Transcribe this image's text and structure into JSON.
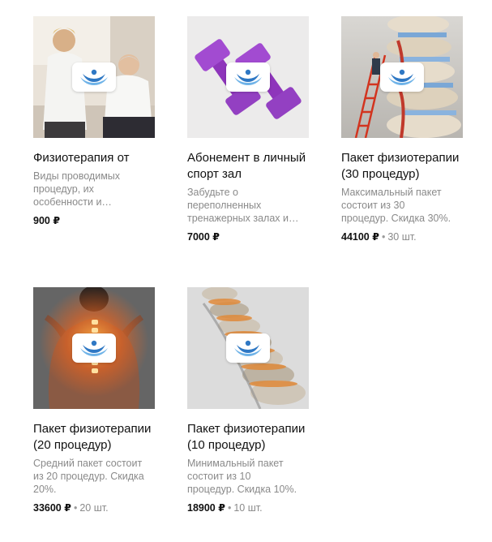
{
  "currency": "₽",
  "products": [
    {
      "title": "Физиотерапия от",
      "description": "Виды проводимых процедур, их особенности и…",
      "price": "900 ₽",
      "separator": "",
      "quantity": ""
    },
    {
      "title": "Абонемент в личный спорт зал",
      "description": "Забудьте о переполненных тренажерных залах и…",
      "price": "7000 ₽",
      "separator": "",
      "quantity": ""
    },
    {
      "title": "Пакет физиотерапии (30 процедур)",
      "description": "Максимальный пакет состоит из 30 процедур. Скидка 30%.",
      "price": "44100 ₽",
      "separator": "•",
      "quantity": "30 шт."
    },
    {
      "title": "Пакет физиотерапии (20 процедур)",
      "description": "Средний пакет состоит из 20 процедур. Скидка 20%.",
      "price": "33600 ₽",
      "separator": "•",
      "quantity": "20 шт."
    },
    {
      "title": "Пакет физиотерапии (10 процедур)",
      "description": "Минимальный пакет состоит из 10 процедур. Скидка 10%.",
      "price": "18900 ₽",
      "separator": "•",
      "quantity": "10 шт."
    }
  ],
  "colors": {
    "logo_blue": "#2f78c4",
    "logo_light": "#6fb3e8",
    "dumbbell_purple": "#9b3fc8",
    "spine_orange": "#e8641f"
  },
  "icons": [
    "physio-logo-icon"
  ]
}
